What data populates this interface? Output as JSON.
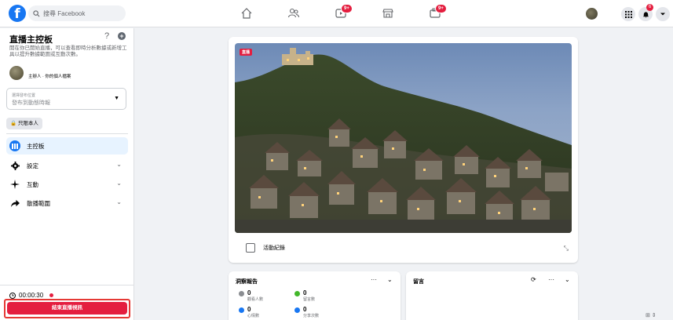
{
  "topbar": {
    "logo": "f",
    "search_placeholder": "搜尋 Facebook",
    "nav_icons": [
      "home-icon",
      "friends-icon",
      "watch-icon",
      "marketplace-icon",
      "gaming-icon"
    ],
    "watch_badge": "9+",
    "gaming_badge": "9+",
    "notifications_badge": "6"
  },
  "sidebar": {
    "title": "直播主控板",
    "help": "?",
    "add": "+",
    "description": "開在你已開始直播，可以查看即時分析數據或新增工具以提升數據範圍或互動次數。",
    "host_label": "主辦人 · 你的個人檔案",
    "select_label": "選擇發布位置",
    "select_value": "發布到動態時報",
    "privacy": "🔒 只限本人",
    "menu": [
      {
        "label": "主控板",
        "icon": "dashboard-icon",
        "active": true
      },
      {
        "label": "設定",
        "icon": "gear-icon",
        "active": false
      },
      {
        "label": "互動",
        "icon": "sparkle-icon",
        "active": false
      },
      {
        "label": "散播範圍",
        "icon": "share-arrow-icon",
        "active": false
      }
    ],
    "timer": "00:00:30",
    "end_button": "結束直播視訊"
  },
  "video": {
    "live_tag": "直播",
    "activity_label": "活動紀錄"
  },
  "insights": {
    "title": "洞察報告",
    "stats": [
      {
        "value": "0",
        "label": "觀看人數",
        "color": "#8a8d91"
      },
      {
        "value": "0",
        "label": "留言數",
        "color": "#42b72a"
      },
      {
        "value": "0",
        "label": "心情數",
        "color": "#1877f2"
      },
      {
        "value": "0",
        "label": "分享次數",
        "color": "#1877f2"
      }
    ]
  },
  "comments": {
    "title": "留言"
  },
  "colors": {
    "brand": "#1877f2",
    "live_red": "#e41e3f",
    "active_bg": "#e7f3ff"
  }
}
